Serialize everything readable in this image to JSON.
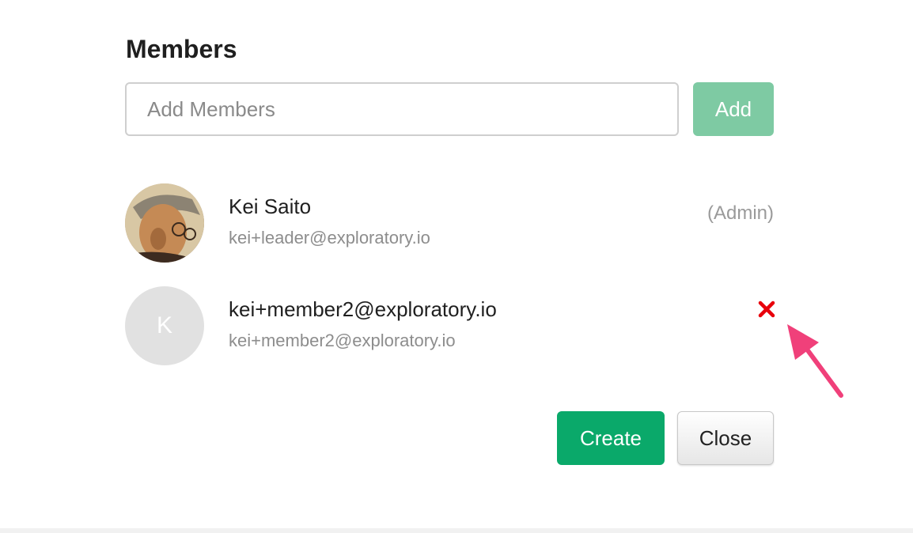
{
  "members_section": {
    "title": "Members",
    "add_input": {
      "placeholder": "Add Members",
      "value": ""
    },
    "add_button_label": "Add",
    "members": [
      {
        "name": "Kei Saito",
        "email": "kei+leader@exploratory.io",
        "role": "(Admin)",
        "avatar": "photo"
      },
      {
        "name": "kei+member2@exploratory.io",
        "email": "kei+member2@exploratory.io",
        "avatar_initial": "K",
        "action_icon": "close-icon"
      }
    ]
  },
  "footer": {
    "create_label": "Create",
    "close_label": "Close"
  },
  "colors": {
    "add_button": "#7ecaa3",
    "create_button": "#0aa96a",
    "remove_icon": "#e8000b",
    "annotation_arrow": "#f0407a"
  }
}
